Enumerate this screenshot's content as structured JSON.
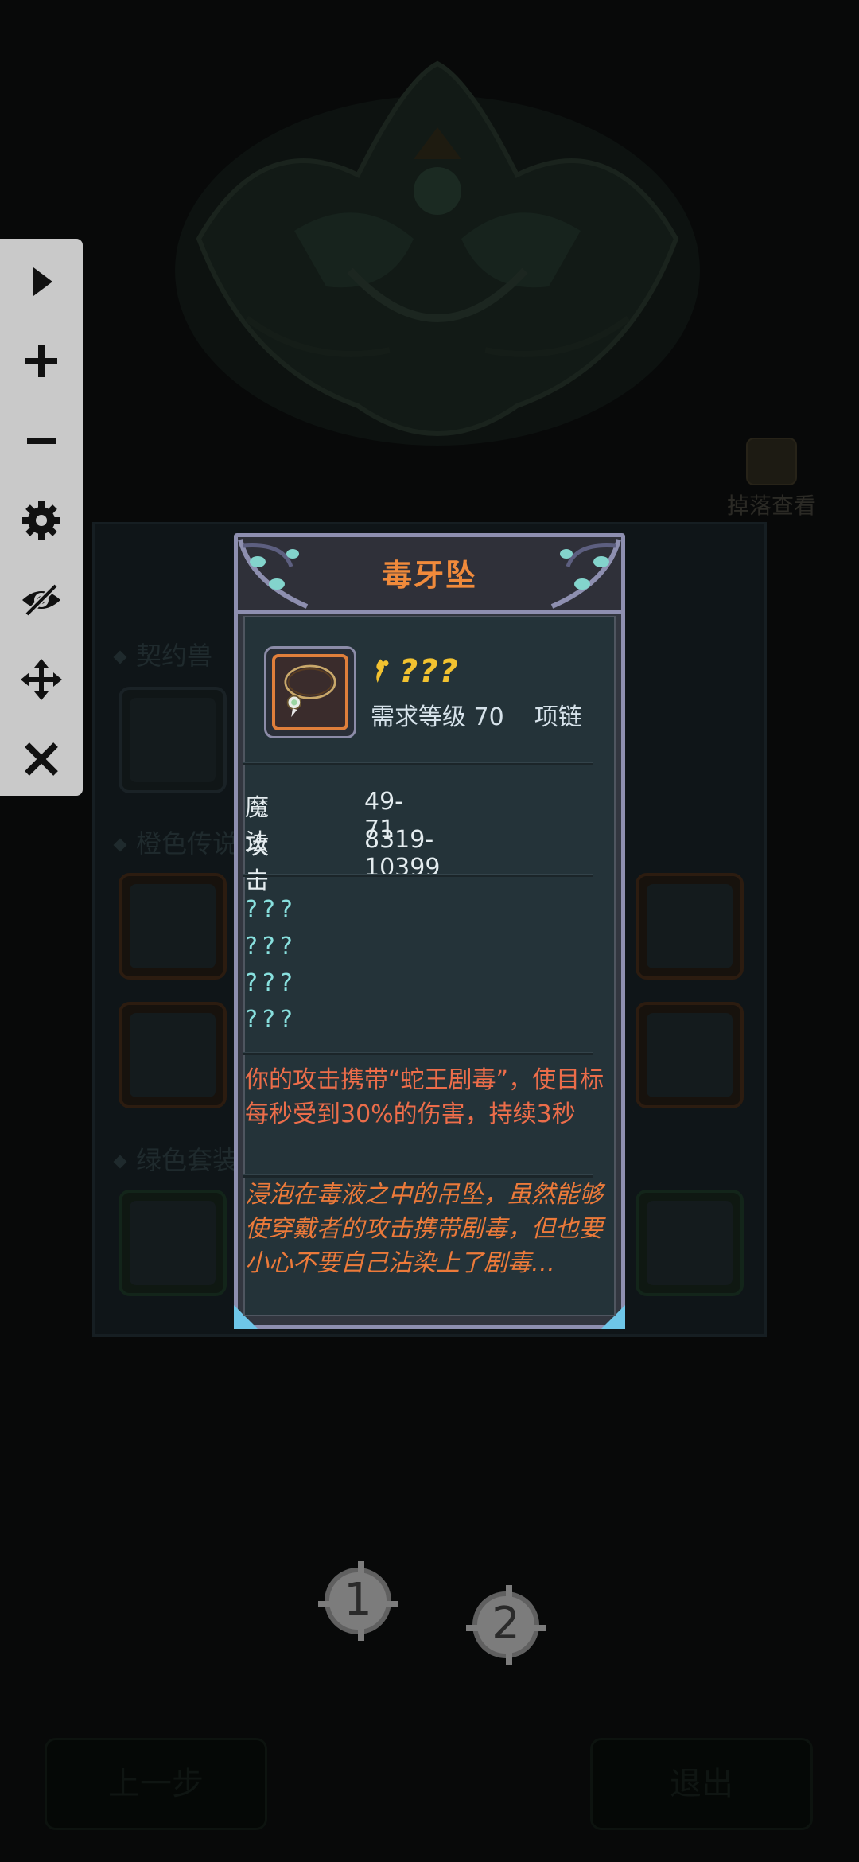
{
  "background": {
    "drop_view_label": "掉落查看",
    "sections": [
      "契约兽",
      "橙色传说",
      "绿色套装"
    ],
    "prev_button": "上一步",
    "exit_button": "退出",
    "pages": [
      "1",
      "2"
    ]
  },
  "toolbar": {
    "items": [
      "play-icon",
      "plus-icon",
      "minus-icon",
      "gear-icon",
      "eye-off-icon",
      "move-icon",
      "close-icon"
    ]
  },
  "tooltip": {
    "title": "毒牙坠",
    "quality_text": "???",
    "requirement": "需求等级 70    项链",
    "stats": [
      {
        "label": "魔法",
        "value": "49-71"
      },
      {
        "label": "攻击",
        "value": "8319-10399"
      }
    ],
    "hidden_attributes": [
      "???",
      "???",
      "???",
      "???"
    ],
    "effect_text": "你的攻击携带“蛇王剧毒”，使目标每秒受到30%的伤害，持续3秒",
    "flavor_text": "浸泡在毒液之中的吊坠，虽然能够使穿戴者的攻击携带剧毒，但也要小心不要自己沾染上了剧毒…"
  },
  "colors": {
    "title": "#f08a3b",
    "quality": "#f2c230",
    "hidden_attr": "#88e0de",
    "effect": "#ec6d4a",
    "frame": "#8e8fb0"
  }
}
